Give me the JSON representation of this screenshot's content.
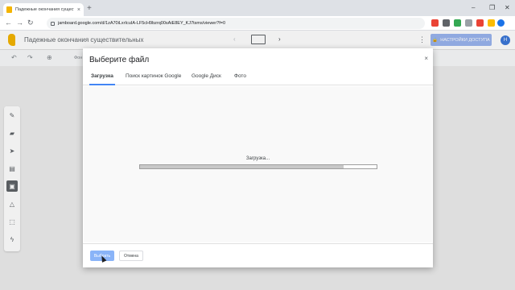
{
  "browser": {
    "tab_title": "Падежные окончания существ...",
    "tab_close": "×",
    "new_tab": "+",
    "url": "jamboard.google.com/d/1zA70iLxrIcuIA-LF5cH9bzrq00sAiE8EY_KJ7tsms/viewer?f=0",
    "window_controls": [
      "–",
      "❐",
      "✕"
    ]
  },
  "app": {
    "doc_title": "Падежные окончания существительных",
    "share_label": "НАСТРОЙКИ ДОСТУПА",
    "avatar_letter": "H",
    "toolbar_font_label": "Фон"
  },
  "dialog": {
    "title": "Выберите файл",
    "close": "×",
    "tabs": [
      "Загрузка",
      "Поиск картинок Google",
      "Google Диск",
      "Фото"
    ],
    "active_tab": 0,
    "loading_text": "Загрузка...",
    "progress": 0.86,
    "select_label": "Выбрать",
    "cancel_label": "Отмена"
  },
  "colors": {
    "accent": "#4285f4",
    "share_bg": "#9ab4ee",
    "logo": "#f4b400"
  }
}
